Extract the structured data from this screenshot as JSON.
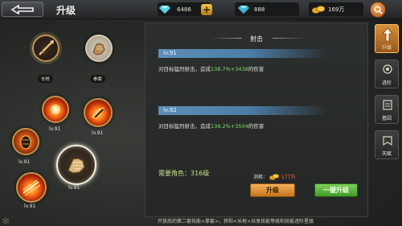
{
  "header": {
    "title": "升级",
    "diamonds": "6486",
    "gems": "888",
    "gold": "169万"
  },
  "skills": [
    {
      "name": "长枪",
      "kind": "spear"
    },
    {
      "name": "拳套",
      "kind": "gauntlet"
    },
    {
      "level": "lv.91",
      "kind": "fire-burst"
    },
    {
      "level": "lv.91",
      "kind": "fire-slash"
    },
    {
      "level": "lv.91",
      "kind": "fire-stone"
    },
    {
      "level": "lv.91",
      "kind": "gauntlet-selected"
    },
    {
      "level": "lv.91",
      "kind": "fire-wave"
    }
  ],
  "detail": {
    "skill_title": "射击",
    "current": {
      "level": "lv.91",
      "desc_prefix": "对目标猛烈射击，造成",
      "desc_value": "138.7%+3438",
      "desc_suffix": "的伤害"
    },
    "next": {
      "level": "lv.92",
      "desc_prefix": "对目标猛烈射击，造成",
      "desc_value": "139.2%+3504",
      "desc_suffix": "的伤害"
    },
    "requirement_label": "需要角色：",
    "requirement_value": "316级",
    "cost_label": "消耗：",
    "cost_value": "177万",
    "upgrade_button": "升级",
    "oneclick_button": "一键升级"
  },
  "footer_note": "开放后的第二套技能<拳套>，将和<长枪>共享技能等级和技能进阶星级",
  "side_tabs": [
    {
      "label": "升级",
      "icon": "upgrade-arrow-icon",
      "active": true
    },
    {
      "label": "进阶",
      "icon": "advance-icon",
      "active": false
    },
    {
      "label": "基因",
      "icon": "gene-icon",
      "active": false
    },
    {
      "label": "天赋",
      "icon": "talent-icon",
      "active": false
    }
  ],
  "colors": {
    "highlight_value": "#7fe06a",
    "cost_value": "#ff6a4a",
    "requirement": "#c8e08a",
    "level_bar": "#5e8fb8",
    "upgrade_button": "#e39a3c",
    "oneclick_button": "#5fb842"
  }
}
